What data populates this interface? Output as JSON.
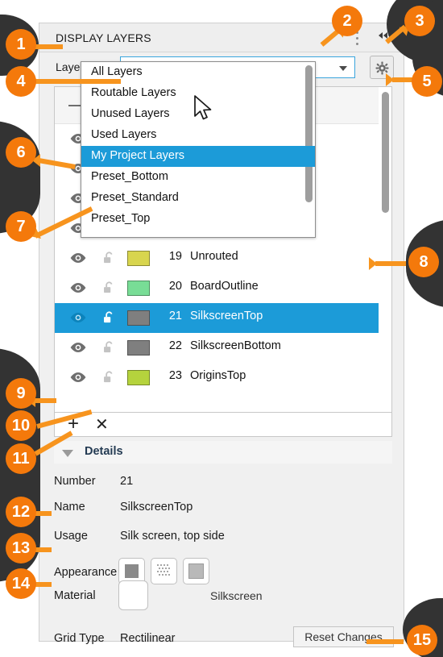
{
  "window": {
    "title": "DISPLAY LAYERS",
    "kebab_icon": "kebab-menu-icon",
    "collapse_icon": "collapse-left-arrows-icon"
  },
  "layer_set": {
    "label": "Layer Set",
    "selected": "All Layers",
    "settings_icon": "gear-icon",
    "options": [
      "All Layers",
      "Routable Layers",
      "Unused Layers",
      "Used Layers",
      "My Project Layers",
      "Preset_Bottom",
      "Preset_Standard",
      "Preset_Top"
    ],
    "highlighted_option": "My Project Layers"
  },
  "layer_list": {
    "header": {
      "visibility_icon": "dash-icon",
      "lock_icon": "unlock-icon"
    },
    "rows": [
      {
        "number": "",
        "name": "",
        "color": "#c9494b",
        "selected": false,
        "radio": false
      },
      {
        "number": "",
        "name": "",
        "color": "#2a9fd8",
        "selected": false,
        "radio": false
      },
      {
        "number": "",
        "name": "",
        "color": "#8ec9a0",
        "selected": false,
        "radio": false
      },
      {
        "number": "",
        "name": "",
        "color": "#8ec9a0",
        "selected": false,
        "radio": false
      },
      {
        "number": "19",
        "name": "Unrouted",
        "color": "#d8d54e",
        "selected": false,
        "radio": false
      },
      {
        "number": "20",
        "name": "BoardOutline",
        "color": "#78dd96",
        "selected": false,
        "radio": false
      },
      {
        "number": "21",
        "name": "SilkscreenTop",
        "color": "#7f7f7f",
        "selected": true,
        "radio": true
      },
      {
        "number": "22",
        "name": "SilkscreenBottom",
        "color": "#7f7f7f",
        "selected": false,
        "radio": false
      },
      {
        "number": "23",
        "name": "OriginsTop",
        "color": "#b5d33d",
        "selected": false,
        "radio": false
      }
    ],
    "add_icon": "plus-icon",
    "remove_icon": "close-x-icon"
  },
  "details": {
    "section_title": "Details",
    "collapse_icon": "triangle-down-icon",
    "fields": [
      {
        "label": "Number",
        "value": "21"
      },
      {
        "label": "Name",
        "value": "SilkscreenTop"
      },
      {
        "label": "Usage",
        "value": "Silk screen, top side"
      },
      {
        "label": "Appearance",
        "value": ""
      },
      {
        "label": "Material",
        "value": "Silkscreen"
      },
      {
        "label": "Grid Type",
        "value": "Rectilinear"
      }
    ],
    "appearance_options": [
      "fill-solid-icon",
      "fill-pattern-icon",
      "fill-outline-icon"
    ],
    "material_swatch_color": "#ffffff",
    "reset_button": "Reset Changes"
  },
  "callouts": [
    {
      "id": "1",
      "target": "panel-title"
    },
    {
      "id": "2",
      "target": "kebab-menu"
    },
    {
      "id": "3",
      "target": "collapse-arrows"
    },
    {
      "id": "4",
      "target": "layer-set-label"
    },
    {
      "id": "5",
      "target": "settings-gear"
    },
    {
      "id": "6",
      "target": "visibility-eye-column"
    },
    {
      "id": "7",
      "target": "lock-column"
    },
    {
      "id": "8",
      "target": "active-layer-radio-column"
    },
    {
      "id": "9",
      "target": "add-layer"
    },
    {
      "id": "10",
      "target": "remove-layer"
    },
    {
      "id": "11",
      "target": "details-expander"
    },
    {
      "id": "12",
      "target": "usage-field"
    },
    {
      "id": "13",
      "target": "appearance-field"
    },
    {
      "id": "14",
      "target": "material-field"
    },
    {
      "id": "15",
      "target": "reset-changes-button"
    }
  ],
  "colors": {
    "accent": "#f4790b",
    "selection": "#1c9bd8",
    "panel_bg": "#f0f0f0",
    "blob": "#333333"
  }
}
